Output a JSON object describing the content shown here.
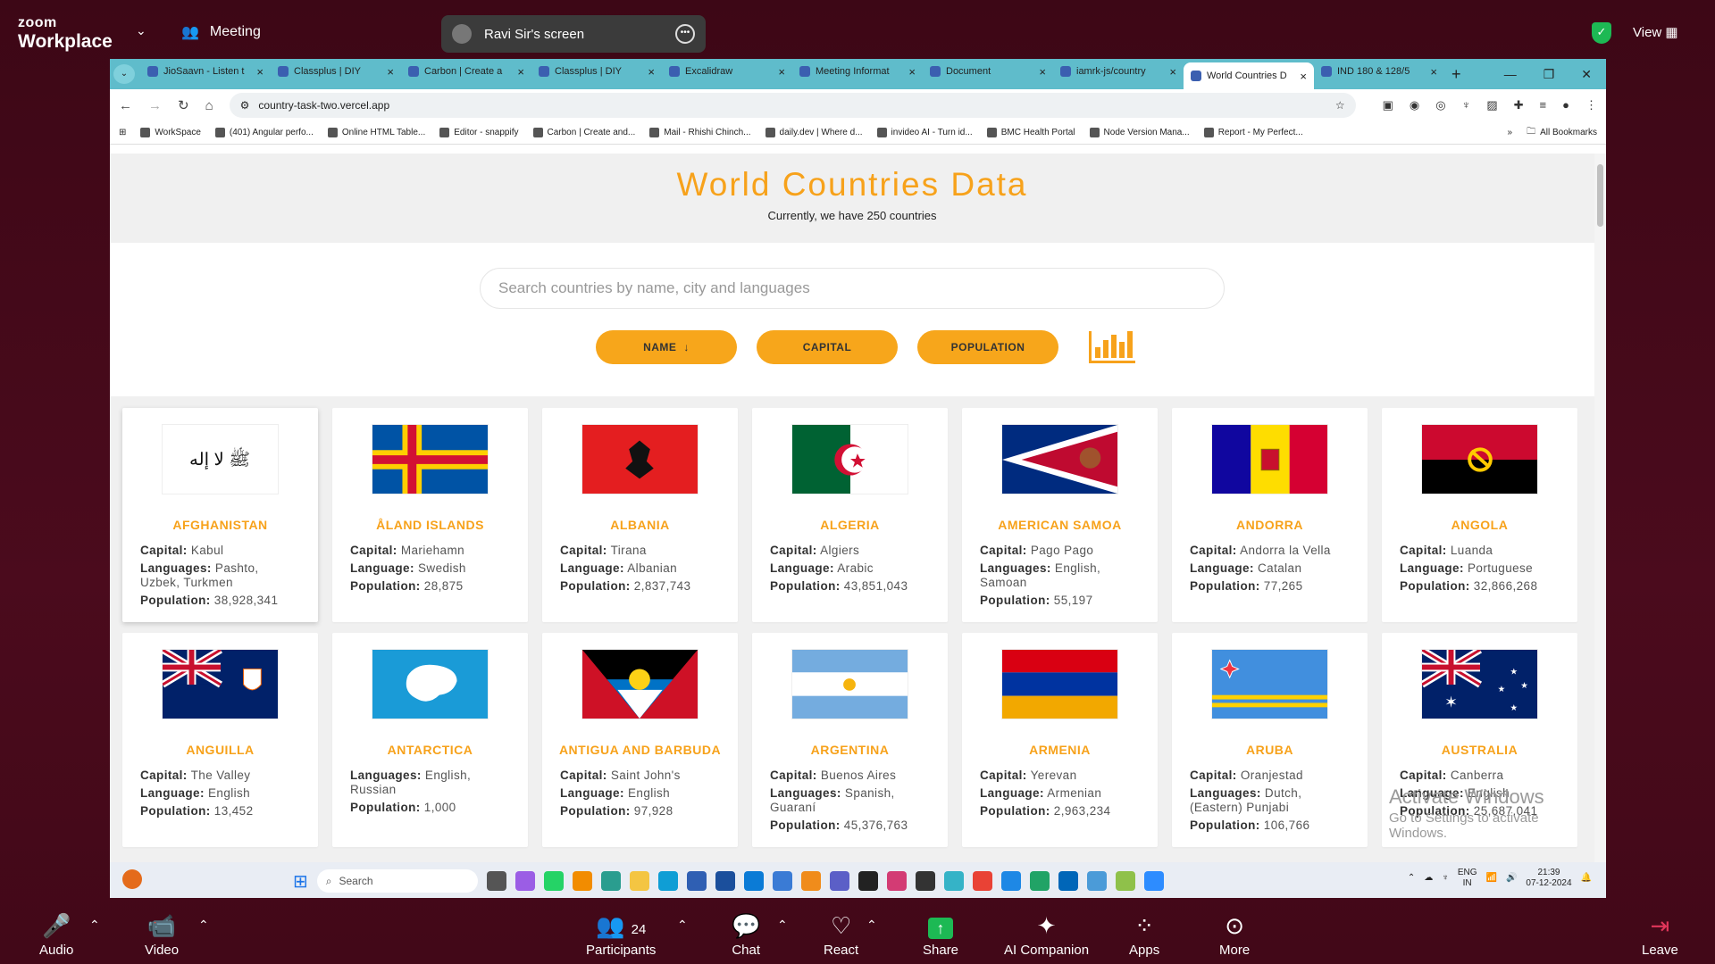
{
  "zoom": {
    "logo_line1": "zoom",
    "logo_line2": "Workplace",
    "meeting_label": "Meeting",
    "screen_share_label": "Ravi Sir's screen",
    "view_label": "View",
    "bottom": {
      "audio": "Audio",
      "video": "Video",
      "participants": "Participants",
      "participants_count": "24",
      "chat": "Chat",
      "react": "React",
      "share": "Share",
      "ai_companion": "AI Companion",
      "apps": "Apps",
      "more": "More",
      "leave": "Leave"
    }
  },
  "browser": {
    "tabs": [
      {
        "title": "JioSaavn - Listen t"
      },
      {
        "title": "Classplus | DIY"
      },
      {
        "title": "Carbon | Create a"
      },
      {
        "title": "Classplus | DIY"
      },
      {
        "title": "Excalidraw"
      },
      {
        "title": "Meeting Informat"
      },
      {
        "title": "Document"
      },
      {
        "title": "iamrk-js/country"
      },
      {
        "title": "World Countries D"
      },
      {
        "title": "IND 180 & 128/5"
      }
    ],
    "active_tab_index": 8,
    "url": "country-task-two.vercel.app",
    "bookmarks": [
      "WorkSpace",
      "(401) Angular perfo...",
      "Online HTML Table...",
      "Editor - snappify",
      "Carbon | Create and...",
      "Mail - Rhishi Chinch...",
      "daily.dev | Where d...",
      "invideo AI - Turn id...",
      "BMC Health Portal",
      "Node Version Mana...",
      "Report - My Perfect..."
    ],
    "all_bookmarks": "All Bookmarks"
  },
  "page": {
    "title": "World Countries Data",
    "subtitle": "Currently, we have 250 countries",
    "search_placeholder": "Search countries by name, city and languages",
    "sort_buttons": {
      "name": "NAME",
      "capital": "CAPITAL",
      "population": "POPULATION"
    },
    "countries": [
      {
        "name": "Afghanistan",
        "capital_label": "Capital:",
        "capital": "Kabul",
        "lang_label": "Languages:",
        "languages": "Pashto, Uzbek, Turkmen",
        "pop_label": "Population:",
        "population": "38,928,341"
      },
      {
        "name": "Åland Islands",
        "capital_label": "Capital:",
        "capital": "Mariehamn",
        "lang_label": "Language:",
        "languages": "Swedish",
        "pop_label": "Population:",
        "population": "28,875"
      },
      {
        "name": "Albania",
        "capital_label": "Capital:",
        "capital": "Tirana",
        "lang_label": "Language:",
        "languages": "Albanian",
        "pop_label": "Population:",
        "population": "2,837,743"
      },
      {
        "name": "Algeria",
        "capital_label": "Capital:",
        "capital": "Algiers",
        "lang_label": "Language:",
        "languages": "Arabic",
        "pop_label": "Population:",
        "population": "43,851,043"
      },
      {
        "name": "American Samoa",
        "capital_label": "Capital:",
        "capital": "Pago Pago",
        "lang_label": "Languages:",
        "languages": "English, Samoan",
        "pop_label": "Population:",
        "population": "55,197"
      },
      {
        "name": "Andorra",
        "capital_label": "Capital:",
        "capital": "Andorra la Vella",
        "lang_label": "Language:",
        "languages": "Catalan",
        "pop_label": "Population:",
        "population": "77,265"
      },
      {
        "name": "Angola",
        "capital_label": "Capital:",
        "capital": "Luanda",
        "lang_label": "Language:",
        "languages": "Portuguese",
        "pop_label": "Population:",
        "population": "32,866,268"
      },
      {
        "name": "Anguilla",
        "capital_label": "Capital:",
        "capital": "The Valley",
        "lang_label": "Language:",
        "languages": "English",
        "pop_label": "Population:",
        "population": "13,452"
      },
      {
        "name": "Antarctica",
        "capital_label": "",
        "capital": "",
        "lang_label": "Languages:",
        "languages": "English, Russian",
        "pop_label": "Population:",
        "population": "1,000"
      },
      {
        "name": "Antigua and Barbuda",
        "capital_label": "Capital:",
        "capital": "Saint John's",
        "lang_label": "Language:",
        "languages": "English",
        "pop_label": "Population:",
        "population": "97,928"
      },
      {
        "name": "Argentina",
        "capital_label": "Capital:",
        "capital": "Buenos Aires",
        "lang_label": "Languages:",
        "languages": "Spanish, Guaraní",
        "pop_label": "Population:",
        "population": "45,376,763"
      },
      {
        "name": "Armenia",
        "capital_label": "Capital:",
        "capital": "Yerevan",
        "lang_label": "Language:",
        "languages": "Armenian",
        "pop_label": "Population:",
        "population": "2,963,234"
      },
      {
        "name": "Aruba",
        "capital_label": "Capital:",
        "capital": "Oranjestad",
        "lang_label": "Languages:",
        "languages": "Dutch, (Eastern) Punjabi",
        "pop_label": "Population:",
        "population": "106,766"
      },
      {
        "name": "Australia",
        "capital_label": "Capital:",
        "capital": "Canberra",
        "lang_label": "Language:",
        "languages": "English",
        "pop_label": "Population:",
        "population": "25,687,041"
      }
    ],
    "activate_title": "Activate Windows",
    "activate_sub": "Go to Settings to activate Windows."
  },
  "taskbar": {
    "search": "Search",
    "lang": "ENG",
    "region": "IN",
    "time": "21:39",
    "date": "07-12-2024"
  },
  "colors": {
    "accent": "#f7a21b",
    "zoom_bg": "#4a0a1c",
    "tab_bar": "#5fbccb"
  }
}
